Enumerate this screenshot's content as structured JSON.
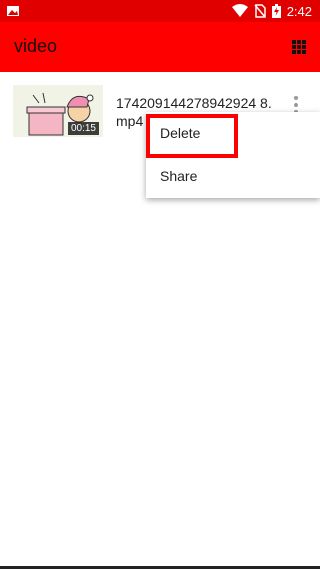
{
  "status_bar": {
    "time": "2:42",
    "icons": [
      "image-icon",
      "wifi-icon",
      "no-sim-icon",
      "battery-charging-icon"
    ]
  },
  "app_bar": {
    "title": "video",
    "grid_icon": "grid-icon"
  },
  "videos": [
    {
      "filename": "1742091442789429248.mp4",
      "filename_display": "174209144278942924 8.mp4",
      "duration": "00:15"
    }
  ],
  "popup_menu": {
    "items": [
      {
        "label": "Delete"
      },
      {
        "label": "Share"
      }
    ]
  },
  "colors": {
    "primary": "#ff0000",
    "status_bar": "#e00000",
    "highlight": "#ff0000"
  }
}
